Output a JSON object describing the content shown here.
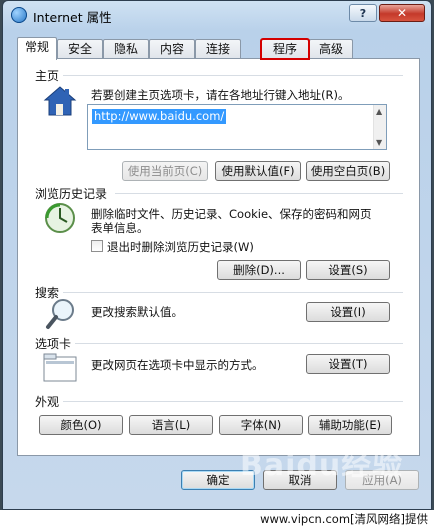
{
  "window": {
    "title": "Internet 属性",
    "help_label": "?",
    "close_label": "✕"
  },
  "tabs": [
    {
      "label": "常规"
    },
    {
      "label": "安全"
    },
    {
      "label": "隐私"
    },
    {
      "label": "内容"
    },
    {
      "label": "连接"
    },
    {
      "label": "程序"
    },
    {
      "label": "高级"
    }
  ],
  "home": {
    "title": "主页",
    "description": "若要创建主页选项卡，请在各地址行键入地址(R)。",
    "url": "http://www.baidu.com/",
    "use_current_label": "使用当前页(C)",
    "use_default_label": "使用默认值(F)",
    "use_blank_label": "使用空白页(B)"
  },
  "history": {
    "title": "浏览历史记录",
    "description_line1": "删除临时文件、历史记录、Cookie、保存的密码和网页",
    "description_line2": "表单信息。",
    "checkbox_label": "退出时删除浏览历史记录(W)",
    "delete_label": "删除(D)...",
    "settings_label": "设置(S)"
  },
  "search": {
    "title": "搜索",
    "description": "更改搜索默认值。",
    "settings_label": "设置(I)"
  },
  "tabbed": {
    "title": "选项卡",
    "description": "更改网页在选项卡中显示的方式。",
    "settings_label": "设置(T)"
  },
  "appearance": {
    "title": "外观",
    "colors_label": "颜色(O)",
    "languages_label": "语言(L)",
    "fonts_label": "字体(N)",
    "accessibility_label": "辅助功能(E)"
  },
  "footer": {
    "ok_label": "确定",
    "cancel_label": "取消",
    "apply_label": "应用(A)"
  },
  "watermark": {
    "text": "Baidu经验"
  },
  "credit": {
    "text": "www.vipcn.com[清风网络]提供"
  },
  "colors": {
    "tab_highlight": "#d40000",
    "selection": "#3399ff"
  }
}
